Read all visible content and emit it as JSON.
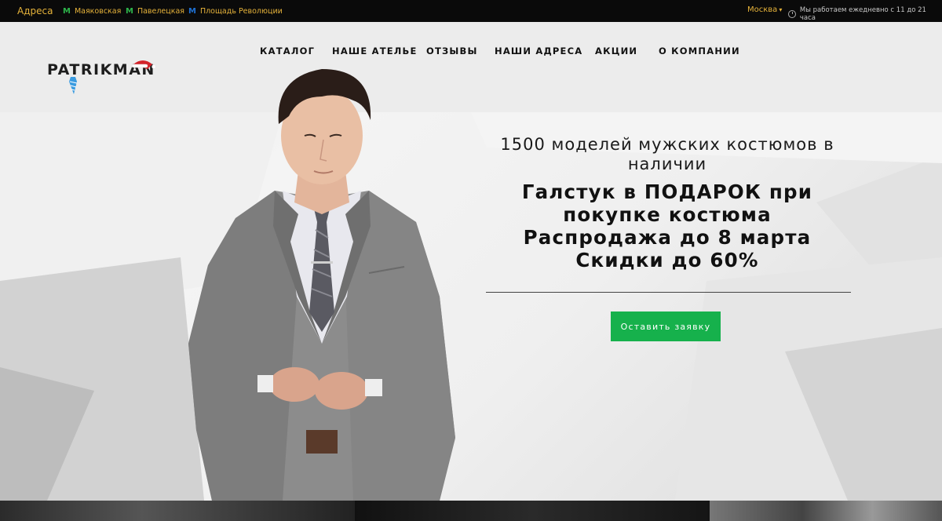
{
  "topbar": {
    "addresses_label": "Адреса",
    "metro_stations": [
      {
        "label": "Маяковская",
        "color": "#2db34a"
      },
      {
        "label": "Павелецкая",
        "color": "#2db34a"
      },
      {
        "label": "Площадь Революции",
        "color": "#1e6fd0"
      }
    ],
    "metro_icon": "М",
    "city": "Москва",
    "hours": "Мы работаем ежедневно с 11 до 21 часа"
  },
  "logo": {
    "text": "PATRIKMAN"
  },
  "nav": {
    "items": [
      "КАТАЛОГ",
      "НАШЕ АТЕЛЬЕ",
      "ОТЗЫВЫ",
      "НАШИ АДРЕСА",
      "АКЦИИ",
      "О КОМПАНИИ"
    ]
  },
  "hero": {
    "subtitle": "1500 моделей мужских костюмов в наличии",
    "headline_lines": [
      "Галстук в ПОДАРОК при",
      "покупке костюма",
      "Распродажа до 8 марта",
      "Скидки до 60%"
    ],
    "cta_label": "Оставить заявку"
  },
  "colors": {
    "topbar_bg": "#0a0a0a",
    "topbar_accent": "#e5b23a",
    "cta_green": "#16b14c"
  }
}
